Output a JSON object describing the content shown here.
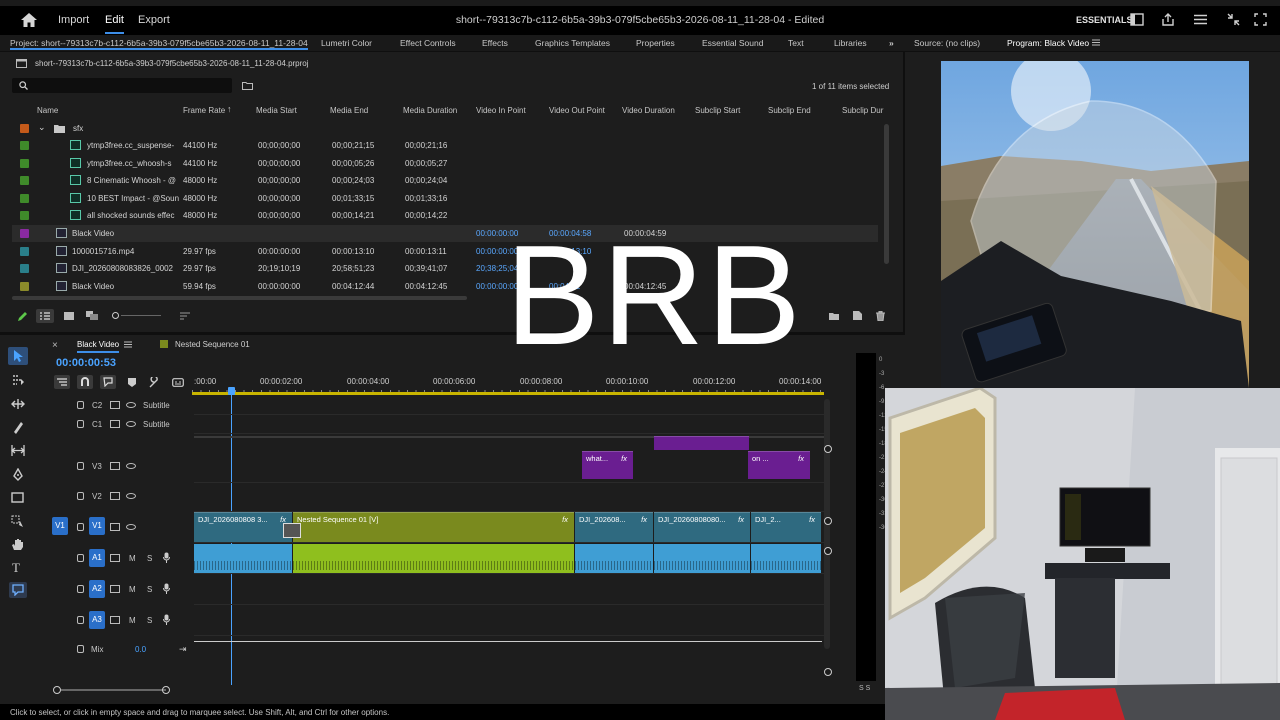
{
  "app": {
    "menu": [
      "Import",
      "Edit",
      "Export"
    ],
    "active_menu": "Edit",
    "title": "short--79313c7b-c112-6b5a-39b3-079f5cbe65b3-2026-08-11_11-28-04 - Edited",
    "workspace": "ESSENTIALS"
  },
  "panel_tabs": [
    "Project: short--79313c7b-c112-6b5a-39b3-079f5cbe65b3-2026-08-11_11-28-04",
    "Lumetri Color",
    "Effect Controls",
    "Effects",
    "Graphics Templates",
    "Properties",
    "Essential Sound",
    "Text",
    "Libraries"
  ],
  "monitor_tabs": [
    "Source: (no clips)",
    "Program: Black Video"
  ],
  "project": {
    "file": "short--79313c7b-c112-6b5a-39b3-079f5cbe65b3-2026-08-11_11-28-04.prproj",
    "selection": "1 of 11 items selected",
    "columns": [
      "Name",
      "Frame Rate",
      "Media Start",
      "Media End",
      "Media Duration",
      "Video In Point",
      "Video Out Point",
      "Video Duration",
      "Subclip Start",
      "Subclip End",
      "Subclip Dur"
    ],
    "folder": "sfx",
    "rows": [
      {
        "name": "ytmp3free.cc_suspense-",
        "rate": "44100 Hz",
        "start": "00;00;00;00",
        "end": "00;00;21;15",
        "dur": "00;00;21;16",
        "vin": "",
        "vout": "",
        "vdur": "",
        "color": "#3f8a2a",
        "kind": "audio"
      },
      {
        "name": "ytmp3free.cc_whoosh-s",
        "rate": "44100 Hz",
        "start": "00;00;00;00",
        "end": "00;00;05;26",
        "dur": "00;00;05;27",
        "vin": "",
        "vout": "",
        "vdur": "",
        "color": "#3f8a2a",
        "kind": "audio"
      },
      {
        "name": "8 Cinematic Whoosh - @",
        "rate": "48000 Hz",
        "start": "00;00;00;00",
        "end": "00;00;24;03",
        "dur": "00;00;24;04",
        "vin": "",
        "vout": "",
        "vdur": "",
        "color": "#3f8a2a",
        "kind": "audio"
      },
      {
        "name": "10 BEST Impact - @Soun",
        "rate": "48000 Hz",
        "start": "00;00;00;00",
        "end": "00;01;33;15",
        "dur": "00;01;33;16",
        "vin": "",
        "vout": "",
        "vdur": "",
        "color": "#3f8a2a",
        "kind": "audio"
      },
      {
        "name": "all shocked sounds effec",
        "rate": "48000 Hz",
        "start": "00;00;00;00",
        "end": "00;00;14;21",
        "dur": "00;00;14;22",
        "vin": "",
        "vout": "",
        "vdur": "",
        "color": "#3f8a2a",
        "kind": "audio"
      },
      {
        "name": "Black Video",
        "rate": "",
        "start": "",
        "end": "",
        "dur": "",
        "vin": "00:00:00:00",
        "vout": "00:00:04:58",
        "vdur": "00:00:04:59",
        "color": "#8a2aa0",
        "kind": "seq"
      },
      {
        "name": "1000015716.mp4",
        "rate": "29.97 fps",
        "start": "00:00:00:00",
        "end": "00:00:13:10",
        "dur": "00:00:13:11",
        "vin": "00:00:00:00",
        "vout": "00:00:13:10",
        "vdur": "00:00:13:11",
        "color": "#2a7f8a",
        "kind": "video"
      },
      {
        "name": "DJI_20260808083826_0002",
        "rate": "29.97 fps",
        "start": "20;19;10;19",
        "end": "20;58;51;23",
        "dur": "00;39;41;07",
        "vin": "20;38;25;04",
        "vout": "",
        "vdur": "",
        "color": "#2a7f8a",
        "kind": "video"
      },
      {
        "name": "Black Video",
        "rate": "59.94 fps",
        "start": "00:00:00:00",
        "end": "00:04:12:44",
        "dur": "00:04:12:45",
        "vin": "00:00:00:00",
        "vout": "00:04:12",
        "vdur": "00:04:12:45",
        "color": "#8a8a2a",
        "kind": "seq"
      }
    ]
  },
  "timeline": {
    "tabs": [
      "Black Video",
      "Nested Sequence 01"
    ],
    "timecode": "00:00:00:53",
    "ruler": [
      ":00:00",
      "00:00:02:00",
      "00:00:04:00",
      "00:00:06:00",
      "00:00:08:00",
      "00:00:10:00",
      "00:00:12:00",
      "00:00:14:00"
    ],
    "tracks": {
      "c2": "C2",
      "c1": "C1",
      "subtitle": "Subtitle",
      "v3": "V3",
      "v2": "V2",
      "v1": "V1",
      "a1": "A1",
      "a2": "A2",
      "a3": "A3",
      "mix": "Mix",
      "mix_value": "0.0",
      "m": "M",
      "s": "S"
    },
    "clips": {
      "v1a": "DJI_2026080808 3...",
      "nested": "Nested Sequence 01 [V]",
      "v1c": "DJI_202608...",
      "v1d": "DJI_20260808080...",
      "v1e": "DJI_2...",
      "v3a": "what...",
      "v3b": "on ...",
      "fx": "fx"
    }
  },
  "overlay": {
    "brb": "BRB"
  },
  "status": "Click to select, or click in empty space and drag to marquee select. Use Shift, Alt, and Ctrl for other options.",
  "meter": [
    "0",
    "-3",
    "-6",
    "-9",
    "-12",
    "-15",
    "-18",
    "-21",
    "-24",
    "-27",
    "-30",
    "-33",
    "-36"
  ],
  "meter_footer": "S S"
}
